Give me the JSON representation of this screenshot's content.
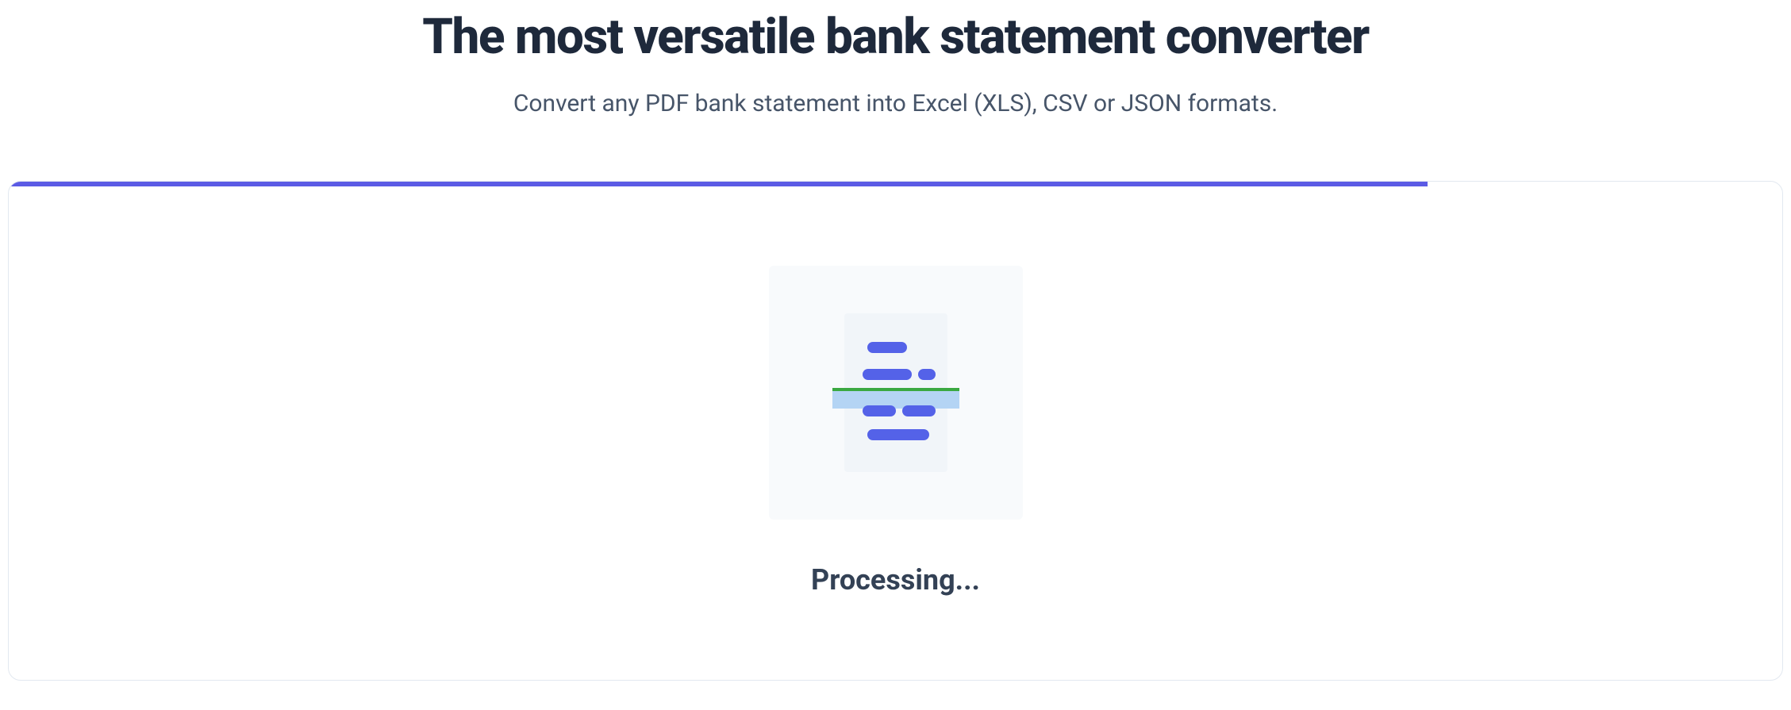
{
  "header": {
    "title": "The most versatile bank statement converter",
    "subtitle": "Convert any PDF bank statement into Excel (XLS), CSV or JSON formats."
  },
  "card": {
    "iconName": "document-scan-icon",
    "statusText": "Processing...",
    "progressPercent": 80
  }
}
